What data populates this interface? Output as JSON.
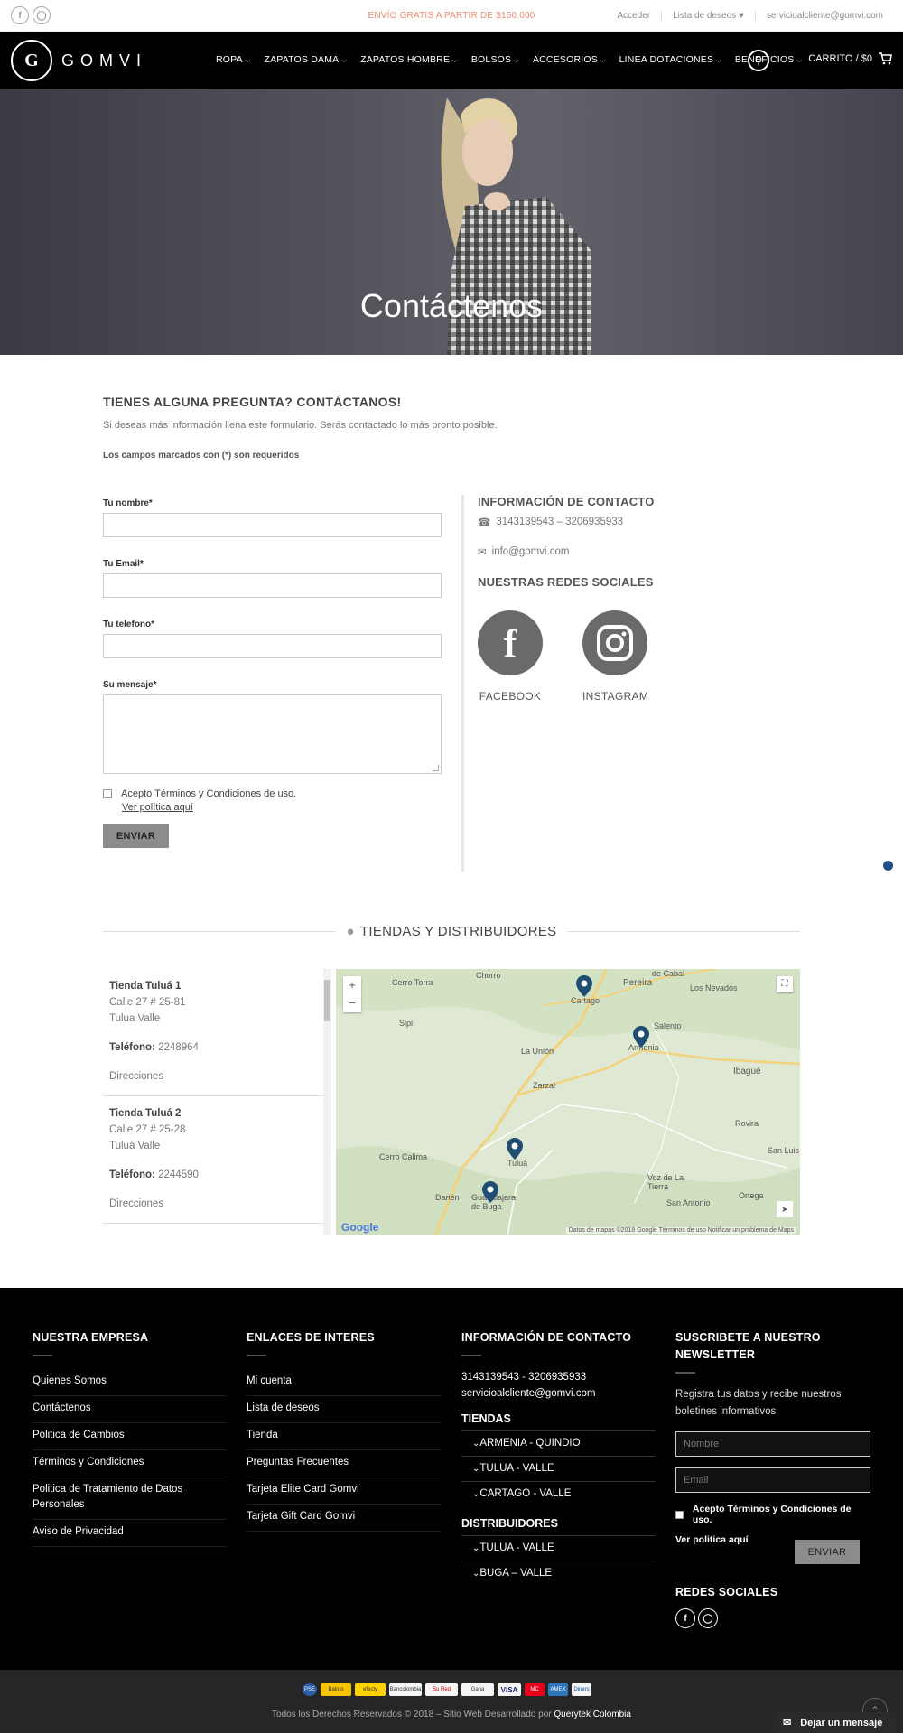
{
  "topbar": {
    "promo": "ENVÍO GRATIS A PARTIR DE $150.000",
    "login": "Acceder",
    "wishlist": "Lista de deseos",
    "email": "servicioalcliente@gomvi.com"
  },
  "header": {
    "logo_text": "GOMVI",
    "logo_mark": "G",
    "nav": [
      "ROPA",
      "ZAPATOS DAMA",
      "ZAPATOS HOMBRE",
      "BOLSOS",
      "ACCESORIOS",
      "LINEA DOTACIONES",
      "BENEFICIOS"
    ],
    "cart": "CARRITO / $0"
  },
  "hero": {
    "title": "Contáctenos"
  },
  "intro": {
    "heading": "TIENES ALGUNA PREGUNTA? CONTÁCTANOS!",
    "text": "Si deseas más información llena este formulario. Serás contactado lo más pronto posible.",
    "required_note": "Los campos marcados con (*) son requeridos"
  },
  "form": {
    "name_label": "Tu nombre*",
    "email_label": "Tu Email*",
    "phone_label": "Tu telefono*",
    "message_label": "Su mensaje*",
    "terms": "Acepto Términos y Condiciones de uso.",
    "policy": "Ver política aquí",
    "submit": "ENVIAR"
  },
  "contact_info": {
    "heading": "INFORMACIÓN DE CONTACTO",
    "phone": "3143139543 – 3206935933",
    "email": "info@gomvi.com",
    "social_heading": "NUESTRAS REDES SOCIALES",
    "facebook": "FACEBOOK",
    "instagram": "INSTAGRAM"
  },
  "stores": {
    "title": "TIENDAS Y DISTRIBUIDORES",
    "list": [
      {
        "name": "Tienda Tuluá 1",
        "address": "Calle 27 # 25-81",
        "city": "Tulua Valle",
        "phone_label": "Teléfono:",
        "phone": "2248964",
        "directions": "Direcciones"
      },
      {
        "name": "Tienda Tuluá 2",
        "address": "Calle 27 # 25-28",
        "city": "Tuluá Valle",
        "phone_label": "Teléfono:",
        "phone": "2244590",
        "directions": "Direcciones"
      }
    ]
  },
  "map": {
    "places": [
      "Cerro Torra",
      "Chorro",
      "Cartago",
      "Pereira",
      "de Cabal",
      "Los Nevados",
      "Sipi",
      "Salento",
      "Armenia",
      "Ibagué",
      "La Unión",
      "Zarzal",
      "Rovira",
      "Tuluá",
      "Cerro Calima",
      "San Luis",
      "Darién",
      "Guadalajara de Buga",
      "Voz de La Tierra",
      "San Antonio",
      "Ortega"
    ],
    "credit": "Datos de mapas ©2018 Google   Términos de uso   Notificar un problema de Maps",
    "google": "Google"
  },
  "footer": {
    "col1": {
      "title": "NUESTRA EMPRESA",
      "items": [
        "Quienes Somos",
        "Contáctenos",
        "Politica de Cambios",
        "Términos y Condiciones",
        "Politica de Tratamiento de Datos Personales",
        "Aviso de Privacidad"
      ]
    },
    "col2": {
      "title": "ENLACES DE INTERES",
      "items": [
        "Mi cuenta",
        "Lista de deseos",
        "Tienda",
        "Preguntas Frecuentes",
        "Tarjeta Elite Card Gomvi",
        "Tarjeta Gift Card Gomvi"
      ]
    },
    "col3": {
      "title": "INFORMACIÓN DE CONTACTO",
      "phone": "3143139543 - 3206935933",
      "email": "servicioalcliente@gomvi.com",
      "stores_title": "TIENDAS",
      "stores": [
        "ARMENIA - QUINDIO",
        "TULUA - VALLE",
        "CARTAGO - VALLE"
      ],
      "dist_title": "DISTRIBUIDORES",
      "dist": [
        "TULUA - VALLE",
        "BUGA – VALLE"
      ]
    },
    "col4": {
      "title": "SUSCRIBETE A NUESTRO NEWSLETTER",
      "text": "Registra tus datos y recibe nuestros boletines informativos",
      "name_placeholder": "Nombre",
      "email_placeholder": "Email",
      "terms": "Acepto Términos y Condiciones de uso.",
      "policy": "Ver politica aquí",
      "submit": "ENVIAR",
      "social_title": "REDES SOCIALES"
    }
  },
  "bottom": {
    "payments": [
      "PSE",
      "Baloto",
      "efecty",
      "Bancolombia",
      "Su Red",
      "Gana",
      "VISA",
      "MC",
      "AMEX",
      "Diners"
    ],
    "copyright": "Todos los Derechos Reservados © 2018 – Sitio Web Desarrollado por ",
    "developer": "Querytek Colombia",
    "chat": "Dejar un mensaje"
  }
}
